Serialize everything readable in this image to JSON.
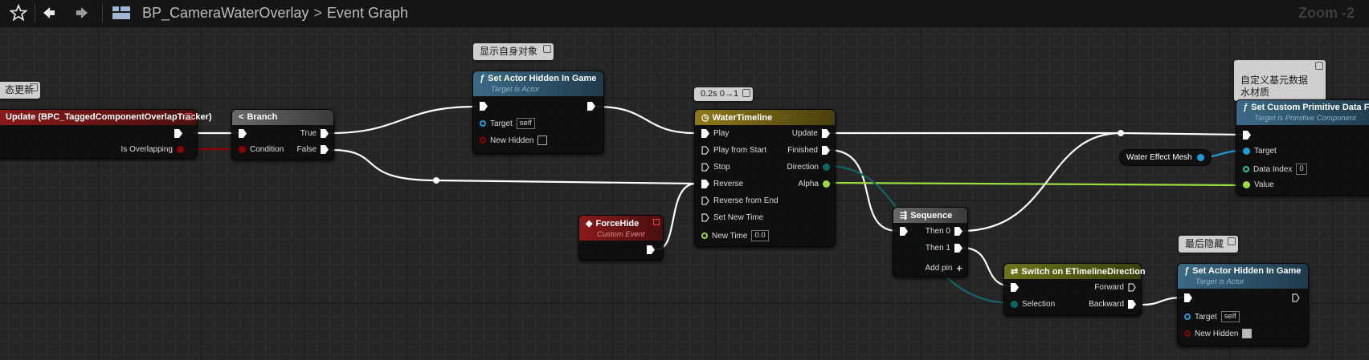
{
  "breadcrumb": {
    "blueprint": "BP_CameraWaterOverlay",
    "graph": "Event Graph"
  },
  "zoom_label": "Zoom -2",
  "comments": {
    "left": "态更新",
    "show_self": "显示自身对象",
    "timeline_tag": "0.2s 0→1",
    "custom_data": "自定义基元数据\n水材质",
    "last_hide": "最后隐藏"
  },
  "nodes": {
    "event": {
      "title": "Update (BPC_TaggedComponentOverlapTracker)",
      "pin_overlap": "Is Overlapping"
    },
    "branch": {
      "title": "Branch",
      "condition": "Condition",
      "true": "True",
      "false": "False"
    },
    "set_hidden_1": {
      "title": "Set Actor Hidden In Game",
      "subtitle": "Target is Actor",
      "target": "Target",
      "target_value": "self",
      "new_hidden": "New Hidden"
    },
    "force_hide": {
      "title": "ForceHide",
      "subtitle": "Custom Event"
    },
    "timeline": {
      "title": "WaterTimeline",
      "inputs": [
        "Play",
        "Play from Start",
        "Stop",
        "Reverse",
        "Reverse from End",
        "Set New Time",
        "New Time"
      ],
      "new_time_value": "0.0",
      "outputs": [
        "Update",
        "Finished",
        "Direction",
        "Alpha"
      ]
    },
    "sequence": {
      "title": "Sequence",
      "then0": "Then 0",
      "then1": "Then 1",
      "add_pin": "Add pin"
    },
    "switch": {
      "title": "Switch on ETimelineDirection",
      "selection": "Selection",
      "forward": "Forward",
      "backward": "Backward"
    },
    "custom_data": {
      "title": "Set Custom Primitive Data Float",
      "subtitle": "Target is Primitive Component",
      "target": "Target",
      "data_index": "Data Index",
      "data_index_value": "0",
      "value": "Value"
    },
    "water_mesh": {
      "label": "Water Effect Mesh"
    },
    "set_hidden_2": {
      "title": "Set Actor Hidden In Game",
      "subtitle": "Target is Actor",
      "target": "Target",
      "target_value": "self",
      "new_hidden": "New Hidden"
    }
  },
  "colors": {
    "exec": "#ffffff",
    "bool": "#8c0202",
    "float": "#9bdc3e",
    "object": "#1f9bd4",
    "enum": "#0f6464",
    "func_header": "#3b6a86",
    "event_header": "#8a1a1a",
    "timeline_header": "#7b6a16",
    "switch_header": "#6d741a",
    "branch_header": "#5b5b5b"
  }
}
